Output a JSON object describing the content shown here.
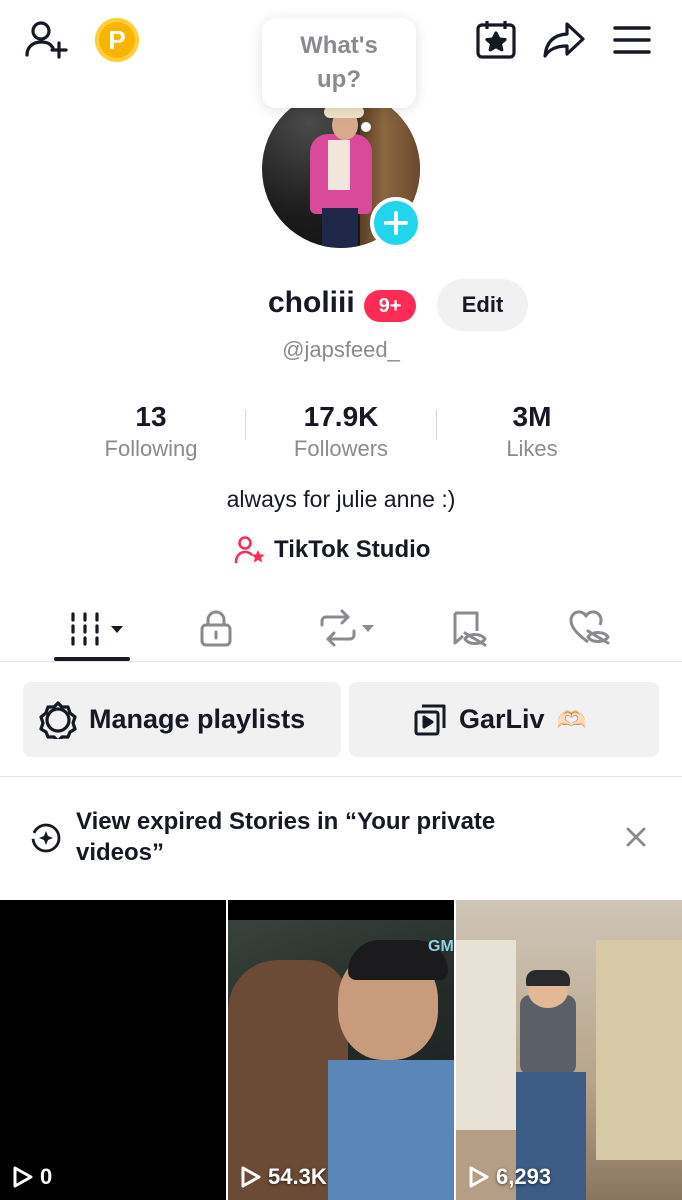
{
  "topbar": {
    "points_letter": "P"
  },
  "bubble": {
    "text": "What's up?"
  },
  "profile": {
    "name": "choliii",
    "notification_badge": "9+",
    "edit_label": "Edit",
    "username": "@japsfeed_",
    "bio": "always for julie anne :)",
    "studio_label": "TikTok Studio"
  },
  "stats": [
    {
      "value": "13",
      "label": "Following"
    },
    {
      "value": "17.9K",
      "label": "Followers"
    },
    {
      "value": "3M",
      "label": "Likes"
    }
  ],
  "tabs": [
    "videos-grid",
    "private",
    "reposts",
    "favorites",
    "liked"
  ],
  "playlists": {
    "manage_label": "Manage playlists",
    "playlist_name": "GarLiv",
    "playlist_emoji": "🫶🏻"
  },
  "notice": {
    "text": "View expired Stories in “Your private videos”"
  },
  "videos": [
    {
      "views": "0"
    },
    {
      "views": "54.3K"
    },
    {
      "views": "6,293"
    }
  ],
  "colors": {
    "accent": "#fe2c55",
    "add_button": "#20d5ec",
    "points": "#f7b500"
  }
}
